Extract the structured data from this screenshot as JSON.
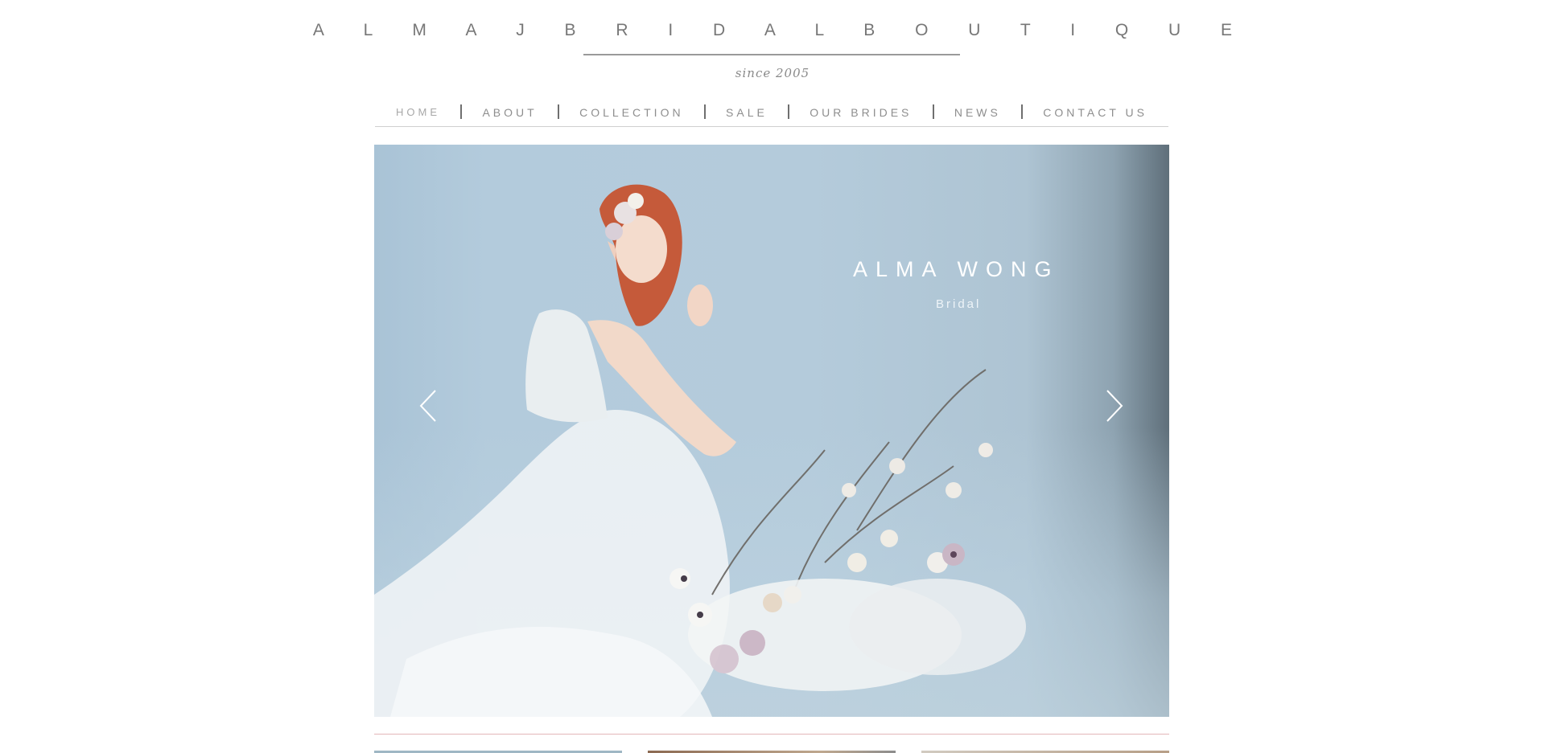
{
  "header": {
    "brand": "A L M A J B R I D A L B O U T I Q U E",
    "since": "since 2005"
  },
  "nav": {
    "items": [
      {
        "label": "HOME",
        "active": true
      },
      {
        "label": "ABOUT"
      },
      {
        "label": "COLLECTION"
      },
      {
        "label": "SALE"
      },
      {
        "label": "OUR BRIDES"
      },
      {
        "label": "NEWS"
      },
      {
        "label": "CONTACT US"
      }
    ]
  },
  "hero": {
    "title": "ALMA WONG",
    "subtitle": "Bridal",
    "prev_icon": "chevron-left-icon",
    "next_icon": "chevron-right-icon"
  },
  "colors": {
    "hero_bg": "#b4cbdb",
    "divider": "#e2b6b8",
    "text": "#8a8a8a"
  }
}
